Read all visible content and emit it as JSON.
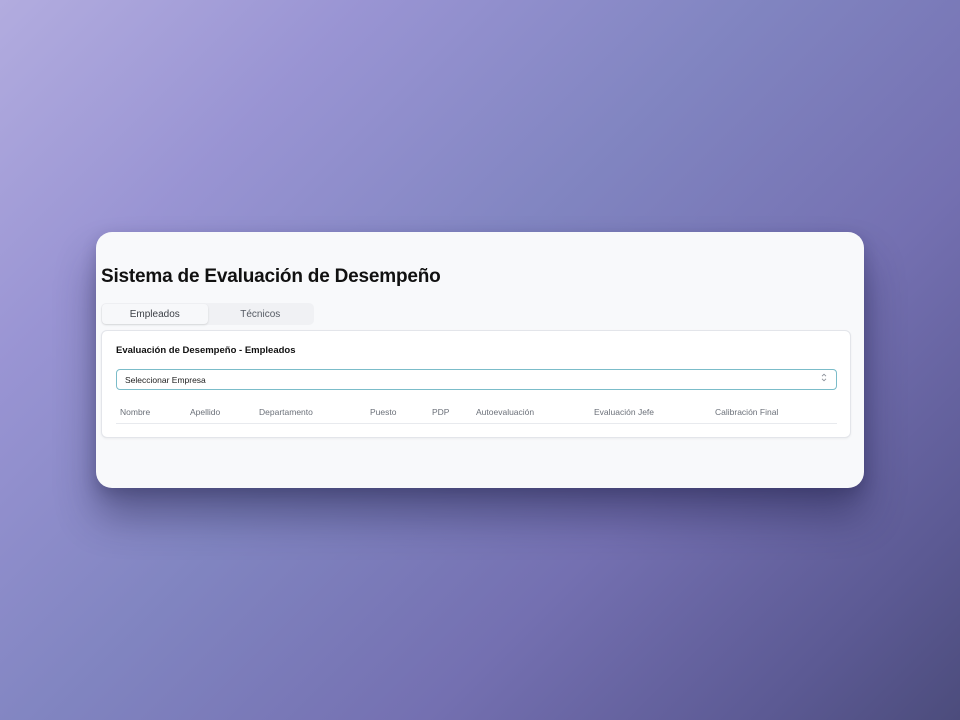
{
  "page": {
    "title": "Sistema de Evaluación de Desempeño"
  },
  "tabs": [
    {
      "label": "Empleados",
      "active": true
    },
    {
      "label": "Técnicos",
      "active": false
    }
  ],
  "card": {
    "title": "Evaluación de Desempeño - Empleados"
  },
  "company_select": {
    "selected": "Seleccionar Empresa",
    "icon": "chevron-up-down-icon"
  },
  "table": {
    "columns": [
      "Nombre",
      "Apellido",
      "Departamento",
      "Puesto",
      "PDP",
      "Autoevaluación",
      "Evaluación Jefe",
      "Calibración Final"
    ],
    "rows": []
  },
  "colors": {
    "select_border": "#7bbcc9",
    "window_bg": "#f8f9fb"
  }
}
